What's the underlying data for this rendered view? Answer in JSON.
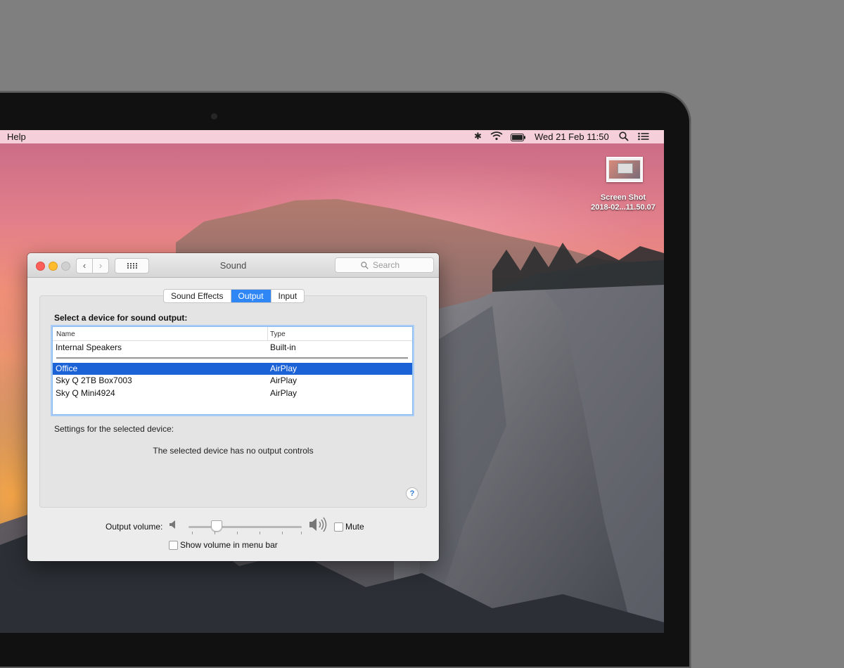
{
  "menubar": {
    "help": "Help",
    "clock": "Wed 21 Feb  11:50",
    "icons": [
      "bluetooth-icon",
      "wifi-icon",
      "battery-icon",
      "spotlight-icon",
      "notification-center-icon"
    ]
  },
  "desktop": {
    "file_name_line1": "Screen Shot",
    "file_name_line2": "2018-02...11.50.07"
  },
  "window": {
    "title": "Sound",
    "search_placeholder": "Search",
    "tabs": [
      "Sound Effects",
      "Output",
      "Input"
    ],
    "active_tab": "Output",
    "select_label": "Select a device for sound output:",
    "table": {
      "columns": [
        "Name",
        "Type"
      ],
      "rows": [
        {
          "name": "Internal Speakers",
          "type": "Built-in",
          "selected": false
        },
        {
          "name": "Office",
          "type": "AirPlay",
          "selected": true
        },
        {
          "name": "Sky Q 2TB Box7003",
          "type": "AirPlay",
          "selected": false
        },
        {
          "name": "Sky Q Mini4924",
          "type": "AirPlay",
          "selected": false
        }
      ]
    },
    "settings_label": "Settings for the selected device:",
    "no_controls": "The selected device has no output controls",
    "help": "?",
    "output_volume_label": "Output volume:",
    "output_volume_level": 0.25,
    "mute_label": "Mute",
    "mute_checked": false,
    "show_volume_label": "Show volume in menu bar",
    "show_volume_checked": false
  },
  "colors": {
    "selection": "#1a62d6",
    "active_tab": "#2f87f5"
  }
}
